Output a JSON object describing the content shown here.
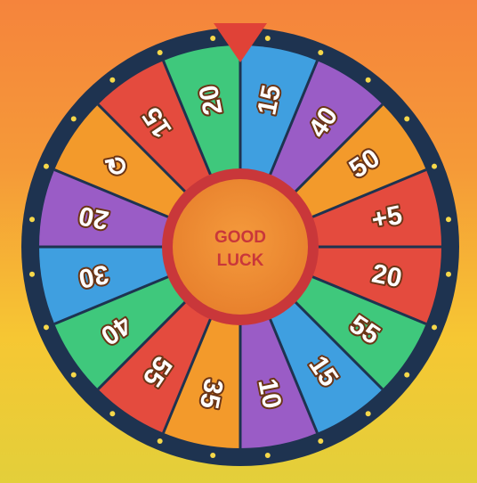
{
  "wheel": {
    "center_label_line1": "GOOD",
    "center_label_line2": "LUCK",
    "segments": [
      {
        "label": "15",
        "color": "#3f9fe0"
      },
      {
        "label": "40",
        "color": "#9a5cc6"
      },
      {
        "label": "50",
        "color": "#f39a2b"
      },
      {
        "label": "+5",
        "color": "#e44b3e"
      },
      {
        "label": "20",
        "color": "#e44b3e"
      },
      {
        "label": "55",
        "color": "#3fc87c"
      },
      {
        "label": "15",
        "color": "#3f9fe0"
      },
      {
        "label": "10",
        "color": "#9a5cc6"
      },
      {
        "label": "35",
        "color": "#f39a2b"
      },
      {
        "label": "55",
        "color": "#e44b3e"
      },
      {
        "label": "40",
        "color": "#3fc87c"
      },
      {
        "label": "30",
        "color": "#3f9fe0"
      },
      {
        "label": "20",
        "color": "#9a5cc6"
      },
      {
        "label": "⟳",
        "color": "#f39a2b"
      },
      {
        "label": "15",
        "color": "#e44b3e"
      },
      {
        "label": "20",
        "color": "#3fc87c"
      }
    ],
    "colors": {
      "rim": "#1e3350",
      "rim_dots": "#f6d84a",
      "divider": "#1e3350",
      "hub_outer": "#c9373a",
      "hub_inner": "#ee8a34",
      "pointer": "#e04237"
    },
    "pointer_icon": "triangle-pointer-icon",
    "respin_icon": "refresh-icon"
  }
}
